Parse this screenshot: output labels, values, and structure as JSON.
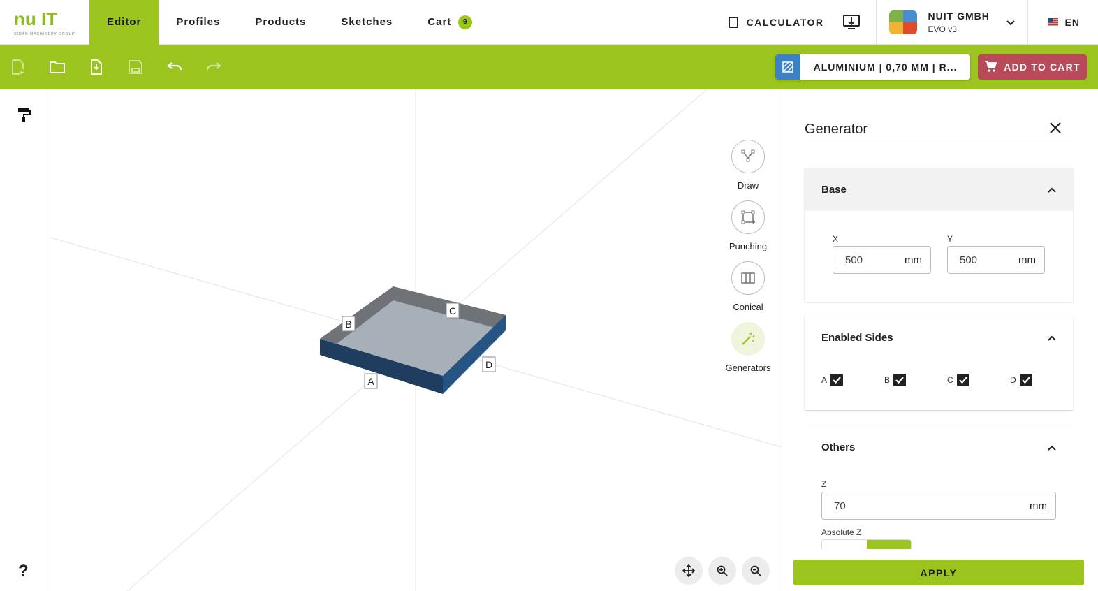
{
  "brand": {
    "logo_text": "nu IT",
    "logo_sub": "CIDAN MACHINERY GROUP"
  },
  "nav": {
    "items": [
      {
        "label": "Editor",
        "active": true
      },
      {
        "label": "Profiles"
      },
      {
        "label": "Products"
      },
      {
        "label": "Sketches"
      },
      {
        "label": "Cart"
      }
    ],
    "cart_count": "9"
  },
  "header": {
    "calculator_label": "CALCULATOR",
    "company_name": "NUIT GMBH",
    "company_version": "EVO v3",
    "language": "EN"
  },
  "toolbar": {
    "material_label": "ALUMINIUM | 0,70 MM | R...",
    "add_to_cart_label": "ADD TO CART",
    "accent_color": "#9cc41e",
    "cart_button_color": "#b84a5a"
  },
  "viewport": {
    "edge_labels": [
      "A",
      "B",
      "C",
      "D"
    ],
    "tools": [
      {
        "label": "Draw",
        "icon": "draw-icon"
      },
      {
        "label": "Punching",
        "icon": "punching-icon"
      },
      {
        "label": "Conical",
        "icon": "conical-icon"
      },
      {
        "label": "Generators",
        "icon": "magic-wand-icon",
        "active": true
      }
    ],
    "zoom_controls": [
      "move-icon",
      "zoom-in-icon",
      "zoom-out-icon"
    ]
  },
  "help": {
    "label": "?"
  },
  "panel": {
    "title": "Generator",
    "base": {
      "title": "Base",
      "x_label": "X",
      "x_value": "500",
      "x_unit": "mm",
      "y_label": "Y",
      "y_value": "500",
      "y_unit": "mm"
    },
    "sides": {
      "title": "Enabled Sides",
      "items": [
        {
          "label": "A",
          "checked": true
        },
        {
          "label": "B",
          "checked": true
        },
        {
          "label": "C",
          "checked": true
        },
        {
          "label": "D",
          "checked": true
        }
      ]
    },
    "others": {
      "title": "Others",
      "z_label": "Z",
      "z_value": "70",
      "z_unit": "mm",
      "absolute_z_label": "Absolute Z"
    },
    "apply_label": "APPLY"
  }
}
